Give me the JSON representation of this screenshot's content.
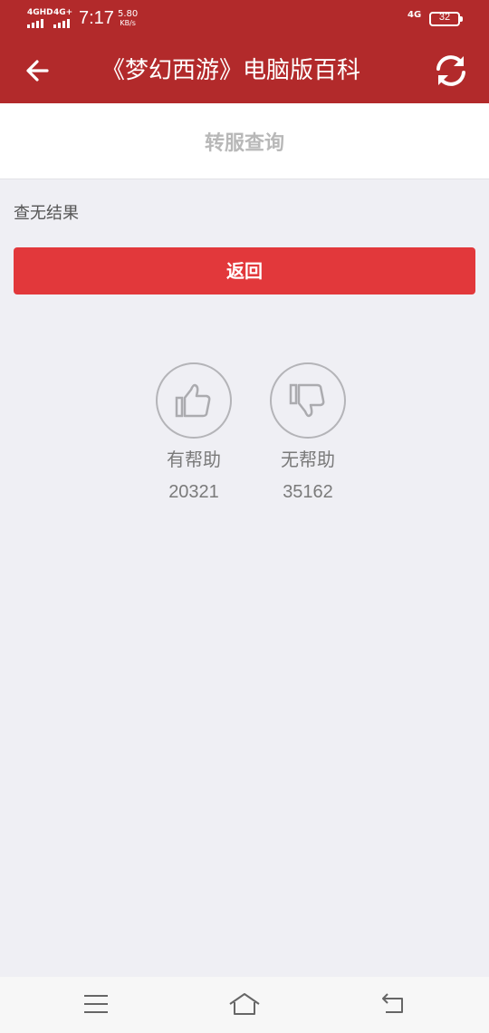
{
  "status_bar": {
    "signal_1": "4GHD",
    "signal_2": "4G+",
    "time": "7:17",
    "speed_value": "5.80",
    "speed_unit": "KB/s",
    "network_right": "4G",
    "battery_level": "32"
  },
  "title_bar": {
    "title": "《梦幻西游》电脑版百科",
    "back_icon": "arrow-left-icon",
    "refresh_icon": "refresh-icon"
  },
  "section": {
    "title": "转服查询"
  },
  "result": {
    "message": "查无结果"
  },
  "actions": {
    "return_label": "返回"
  },
  "feedback": {
    "helpful_label": "有帮助",
    "helpful_count": "20321",
    "helpful_icon": "thumbs-up-icon",
    "unhelpful_label": "无帮助",
    "unhelpful_count": "35162",
    "unhelpful_icon": "thumbs-down-icon"
  },
  "bottom_nav": {
    "menu_icon": "menu-icon",
    "home_icon": "home-icon",
    "back_icon": "back-icon"
  },
  "colors": {
    "header_bg": "#b22a2b",
    "button_bg": "#e2383b",
    "page_bg": "#efeff4"
  }
}
